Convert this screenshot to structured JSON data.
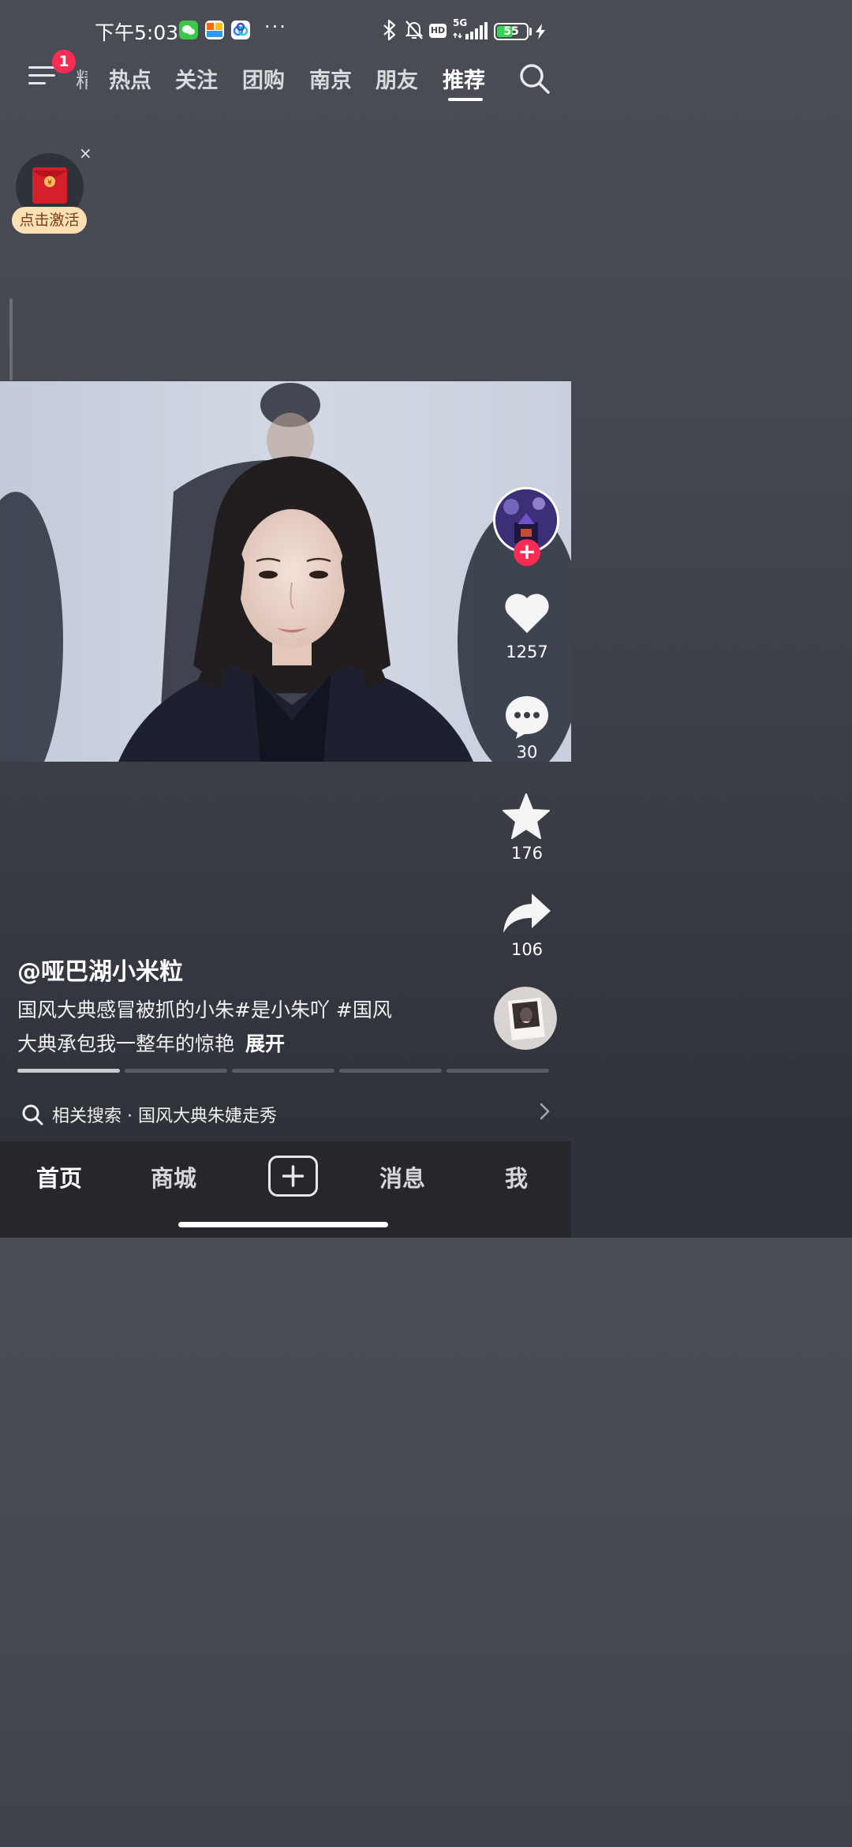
{
  "status_bar": {
    "time": "下午5:03",
    "more": "···",
    "network": "5G",
    "battery": "55",
    "battery_level_percent": 55
  },
  "top_tabs": {
    "menu_badge": "1",
    "partial": "精选",
    "items": [
      "热点",
      "关注",
      "团购",
      "南京",
      "朋友",
      "推荐"
    ],
    "active": "推荐"
  },
  "red_packet": {
    "label": "点击激活",
    "close": "×"
  },
  "actions": {
    "likes": "1257",
    "comments": "30",
    "favorites": "176",
    "shares": "106"
  },
  "post": {
    "author": "@哑巴湖小米粒",
    "caption_line1": "国风大典感冒被抓的小朱#是小朱吖 #国风",
    "caption_line2": "大典承包我一整年的惊艳",
    "expand": "展开"
  },
  "progress": {
    "segments": 5,
    "current_segment": 1,
    "current_fill_percent": 100
  },
  "related_search": {
    "text": "相关搜索 · 国风大典朱婕走秀"
  },
  "bottom_nav": {
    "items": [
      "首页",
      "商城",
      "消息",
      "我"
    ],
    "active": "首页"
  },
  "colors": {
    "accent": "#fe2c55",
    "red_packet_label_bg": "#fbe0b6",
    "nav_bg": "#26272d"
  }
}
